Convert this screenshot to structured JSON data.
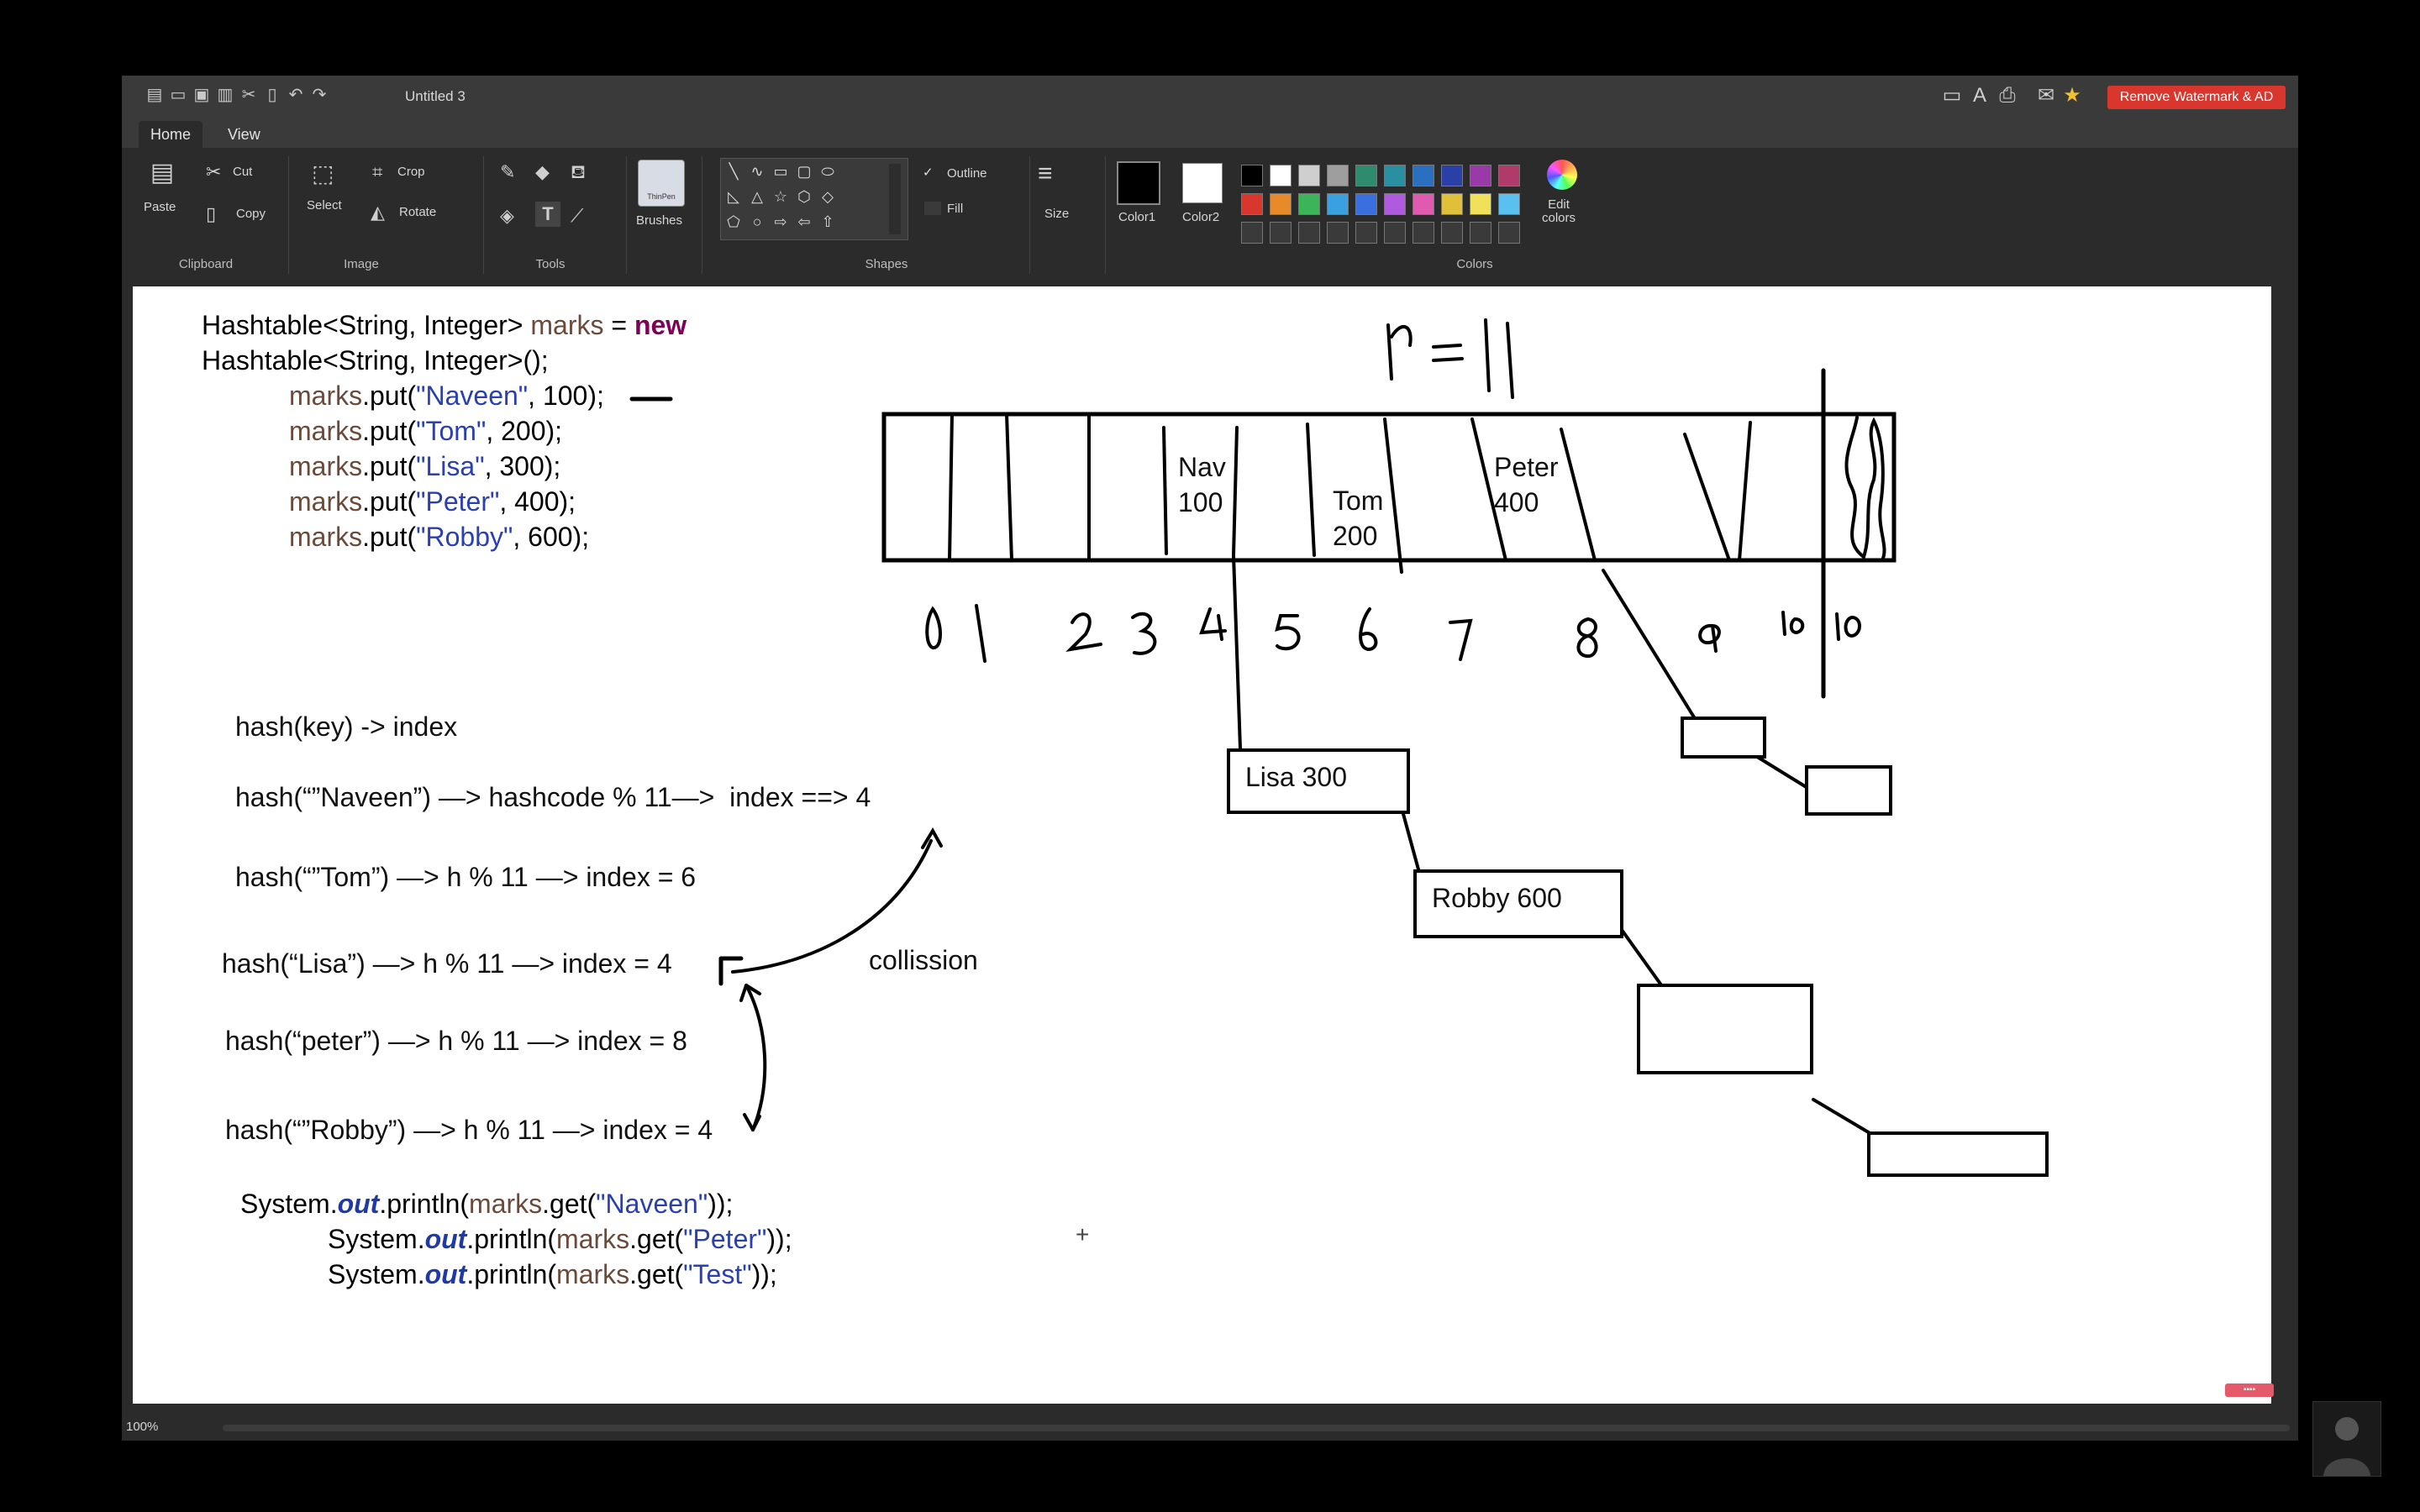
{
  "window": {
    "title": "Untitled 3"
  },
  "topbar": {
    "watermark_button": "Remove Watermark & AD"
  },
  "tabs": [
    "Home",
    "View"
  ],
  "ribbon": {
    "clipboard": {
      "paste": "Paste",
      "cut": "Cut",
      "copy": "Copy",
      "label": "Clipboard"
    },
    "image": {
      "select": "Select",
      "crop": "Crop",
      "rotate": "Rotate",
      "label": "Image"
    },
    "tools": {
      "label": "Tools"
    },
    "brushes": {
      "label": "Brushes",
      "badge": "ThinPen"
    },
    "shapes": {
      "outline": "Outline",
      "fill": "Fill",
      "label": "Shapes"
    },
    "size": {
      "label": "Size"
    },
    "colors": {
      "color1": "Color1",
      "color2": "Color2",
      "edit": "Edit\ncolors",
      "label": "Colors",
      "palette_row1": [
        "#000000",
        "#ffffff",
        "#cfcfcf",
        "#9e9e9e",
        "#2e8b6e",
        "#2a8fa0",
        "#2a6fc0",
        "#2a3fa8",
        "#9a3aa8",
        "#b03a6a"
      ],
      "palette_row2": [
        "#d9372e",
        "#e88a2a",
        "#3cb55a",
        "#3aa0e0",
        "#3a6fe0",
        "#b05ae0",
        "#e05ab0",
        "#e0c03a",
        "#f0e05a",
        "#5ac0f0"
      ]
    }
  },
  "code": {
    "line1": {
      "a": "Hashtable<String, Integer> ",
      "b": "marks",
      "c": " = ",
      "d": "new"
    },
    "line2": "Hashtable<String, Integer>();",
    "puts": [
      {
        "var": "marks",
        "m": ".put(",
        "s": "\"Naveen\"",
        "r": ", 100);"
      },
      {
        "var": "marks",
        "m": ".put(",
        "s": "\"Tom\"",
        "r": ", 200);"
      },
      {
        "var": "marks",
        "m": ".put(",
        "s": "\"Lisa\"",
        "r": ", 300);"
      },
      {
        "var": "marks",
        "m": ".put(",
        "s": "\"Peter\"",
        "r": ", 400);"
      },
      {
        "var": "marks",
        "m": ".put(",
        "s": "\"Robby\"",
        "r": ", 600);"
      }
    ],
    "prints": [
      {
        "a": "System.",
        "f": "out",
        "b": ".println(",
        "v": "marks",
        "c": ".get(",
        "s": "\"Naveen\"",
        "d": "));"
      },
      {
        "a": "System.",
        "f": "out",
        "b": ".println(",
        "v": "marks",
        "c": ".get(",
        "s": "\"Peter\"",
        "d": "));"
      },
      {
        "a": "System.",
        "f": "out",
        "b": ".println(",
        "v": "marks",
        "c": ".get(",
        "s": "\"Test\"",
        "d": "));"
      }
    ]
  },
  "notes": {
    "hash_rule": "hash(key) -> index",
    "naveen": "hash(“”Naveen”) —> hashcode % 11—>  index ==> 4",
    "tom": "hash(“”Tom”) —> h % 11 —> index = 6",
    "lisa": "hash(“Lisa”) —> h % 11 —> index = 4",
    "peter": "hash(“peter”) —> h % 11 —> index = 8",
    "robby": "hash(“”Robby”) —> h % 11 —> index = 4",
    "collision": "collission"
  },
  "array": {
    "n_label": "n=11",
    "cells": {
      "nav": "Nav\n100",
      "tom": "Tom\n200",
      "peter": "Peter\n400"
    },
    "indices": [
      "0",
      "1",
      "2",
      "3",
      "4",
      "5",
      "6",
      "7",
      "8",
      "9",
      "10",
      "10"
    ]
  },
  "chain_boxes": {
    "lisa": "Lisa 300",
    "robby": "Robby 600"
  },
  "status": {
    "zoom": "100%"
  }
}
